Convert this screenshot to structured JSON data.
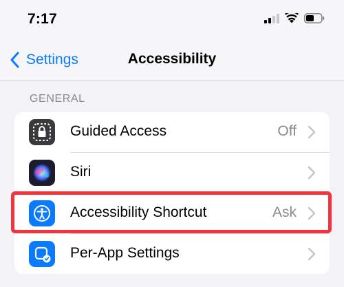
{
  "status_bar": {
    "time": "7:17",
    "icons": [
      "cellular-signal-icon",
      "wifi-icon",
      "battery-icon"
    ]
  },
  "nav": {
    "back_label": "Settings",
    "title": "Accessibility"
  },
  "section": {
    "header": "GENERAL"
  },
  "rows": [
    {
      "label": "Guided Access",
      "value": "Off",
      "icon": "guided-access-icon",
      "icon_color": "#3a3a3c"
    },
    {
      "label": "Siri",
      "value": "",
      "icon": "siri-icon",
      "icon_color": "#1c1c2e"
    },
    {
      "label": "Accessibility Shortcut",
      "value": "Ask",
      "icon": "accessibility-icon",
      "icon_color": "#0a7aff",
      "highlighted": true
    },
    {
      "label": "Per-App Settings",
      "value": "",
      "icon": "per-app-settings-icon",
      "icon_color": "#0a7aff"
    }
  ],
  "colors": {
    "accent": "#0a7aff",
    "highlight": "#f2343f",
    "secondary_text": "#8a8a8e"
  }
}
